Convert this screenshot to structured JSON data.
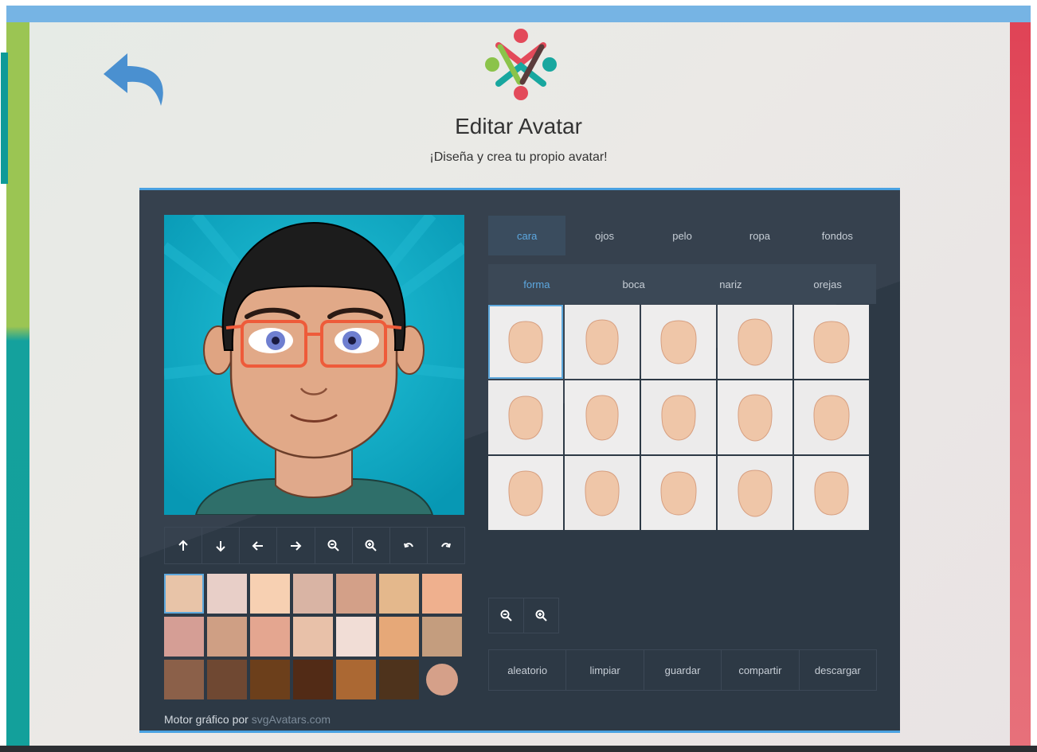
{
  "header": {
    "title": "Editar Avatar",
    "subtitle": "¡Diseña y crea tu propio avatar!",
    "back_icon": "back-arrow-icon",
    "logo": "people-logo"
  },
  "preview": {
    "controls": [
      {
        "name": "move-up-button",
        "icon": "arrow-up-icon"
      },
      {
        "name": "move-down-button",
        "icon": "arrow-down-icon"
      },
      {
        "name": "move-left-button",
        "icon": "arrow-left-icon"
      },
      {
        "name": "move-right-button",
        "icon": "arrow-right-icon"
      },
      {
        "name": "zoom-out-button",
        "icon": "zoom-out-icon"
      },
      {
        "name": "zoom-in-button",
        "icon": "zoom-in-icon"
      },
      {
        "name": "undo-button",
        "icon": "undo-icon"
      },
      {
        "name": "redo-button",
        "icon": "redo-icon"
      }
    ]
  },
  "skin_colors": [
    "#e8c4a8",
    "#e8cfc8",
    "#f7d0b2",
    "#d9b4a4",
    "#d3a088",
    "#e4b88c",
    "#efb08e",
    "#d59e95",
    "#cf9f84",
    "#e4a690",
    "#e8c1a9",
    "#f1ddd6",
    "#e6a878",
    "#c49d7e",
    "#8b6049",
    "#6f4832",
    "#6c3f1b",
    "#522b16",
    "#ab6833",
    "#4e331c",
    "#d5a089"
  ],
  "credit": {
    "prefix": "Motor gráfico por",
    "link": "svgAvatars.com"
  },
  "tabs": [
    "cara",
    "ojos",
    "pelo",
    "ropa",
    "fondos"
  ],
  "active_tab": "cara",
  "subtabs": [
    "forma",
    "boca",
    "nariz",
    "orejas"
  ],
  "active_subtab": "forma",
  "face_shapes_count": 15,
  "zoom": [
    {
      "name": "options-zoom-out-button",
      "icon": "zoom-out-icon"
    },
    {
      "name": "options-zoom-in-button",
      "icon": "zoom-in-icon"
    }
  ],
  "actions": [
    "aleatorio",
    "limpiar",
    "guardar",
    "compartir",
    "descargar"
  ],
  "colors": {
    "accent": "#4aa2e2",
    "panel": "#2f3b48",
    "face_skin": "#efc6a8"
  }
}
